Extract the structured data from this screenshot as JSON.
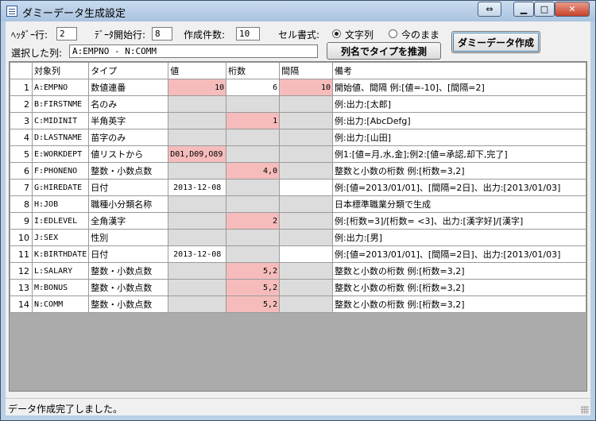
{
  "window": {
    "title": "ダミーデータ生成設定"
  },
  "controls": {
    "header_row_label": "ﾍｯﾀﾞｰ行:",
    "header_row_value": "2",
    "data_start_label": "ﾃﾞｰﾀ開始行:",
    "data_start_value": "8",
    "count_label": "作成件数:",
    "count_value": "10",
    "cell_format_label": "セル書式:",
    "radio_string": "文字列",
    "radio_asis": "今のまま",
    "selected_cols_label": "選択した列:",
    "selected_cols_value": "A:EMPNO - N:COMM",
    "guess_button": "列名でタイプを推測",
    "create_button": "ダミーデータ作成"
  },
  "grid": {
    "headers": [
      "対象列",
      "タイプ",
      "値",
      "桁数",
      "間隔",
      "備考"
    ],
    "rows": [
      {
        "no": "1",
        "col": "A:EMPNO",
        "type": "数値連番",
        "value": "10",
        "digits": "6",
        "interval": "10",
        "note": "開始値、間隔 例:[値=-10]、[間隔=2]"
      },
      {
        "no": "2",
        "col": "B:FIRSTNME",
        "type": "名のみ",
        "value": "",
        "digits": "",
        "interval": "",
        "note": "例:出力:[太郎]"
      },
      {
        "no": "3",
        "col": "C:MIDINIT",
        "type": "半角英字",
        "value": "",
        "digits": "1",
        "interval": "",
        "note": "例:出力:[AbcDefg]"
      },
      {
        "no": "4",
        "col": "D:LASTNAME",
        "type": "苗字のみ",
        "value": "",
        "digits": "",
        "interval": "",
        "note": "例:出力:[山田]"
      },
      {
        "no": "5",
        "col": "E:WORKDEPT",
        "type": "値リストから",
        "value": "D01,D09,O89",
        "digits": "",
        "interval": "",
        "note": "例1:[値=月,水,金];例2:[値=承認,却下,完了]"
      },
      {
        "no": "6",
        "col": "F:PHONENO",
        "type": "整数・小数点数",
        "value": "",
        "digits": "4,0",
        "interval": "",
        "note": "整数と小数の桁数 例:[桁数=3,2]"
      },
      {
        "no": "7",
        "col": "G:HIREDATE",
        "type": "日付",
        "value": "2013-12-08",
        "digits": "",
        "interval": "",
        "note": "例:[値=2013/01/01]、[間隔=2日]、出力:[2013/01/03]"
      },
      {
        "no": "8",
        "col": "H:JOB",
        "type": "職種小分類名称",
        "value": "",
        "digits": "",
        "interval": "",
        "note": "日本標準職業分類で生成"
      },
      {
        "no": "9",
        "col": "I:EDLEVEL",
        "type": "全角漢字",
        "value": "",
        "digits": "2",
        "interval": "",
        "note": "例:[桁数=3]/[桁数= <3]、出力:[漢字好]/[漢字]"
      },
      {
        "no": "10",
        "col": "J:SEX",
        "type": "性別",
        "value": "",
        "digits": "",
        "interval": "",
        "note": "例:出力:[男]"
      },
      {
        "no": "11",
        "col": "K:BIRTHDATE",
        "type": "日付",
        "value": "2013-12-08",
        "digits": "",
        "interval": "",
        "note": "例:[値=2013/01/01]、[間隔=2日]、出力:[2013/01/03]"
      },
      {
        "no": "12",
        "col": "L:SALARY",
        "type": "整数・小数点数",
        "value": "",
        "digits": "5,2",
        "interval": "",
        "note": "整数と小数の桁数 例:[桁数=3,2]"
      },
      {
        "no": "13",
        "col": "M:BONUS",
        "type": "整数・小数点数",
        "value": "",
        "digits": "5,2",
        "interval": "",
        "note": "整数と小数の桁数 例:[桁数=3,2]"
      },
      {
        "no": "14",
        "col": "N:COMM",
        "type": "整数・小数点数",
        "value": "",
        "digits": "5,2",
        "interval": "",
        "note": "整数と小数の桁数 例:[桁数=3,2]"
      }
    ]
  },
  "status": {
    "text": "データ作成完了しました。"
  },
  "colors": {
    "pink_cell": "#f6bcbc",
    "gray_cell": "#dcdcdc"
  }
}
